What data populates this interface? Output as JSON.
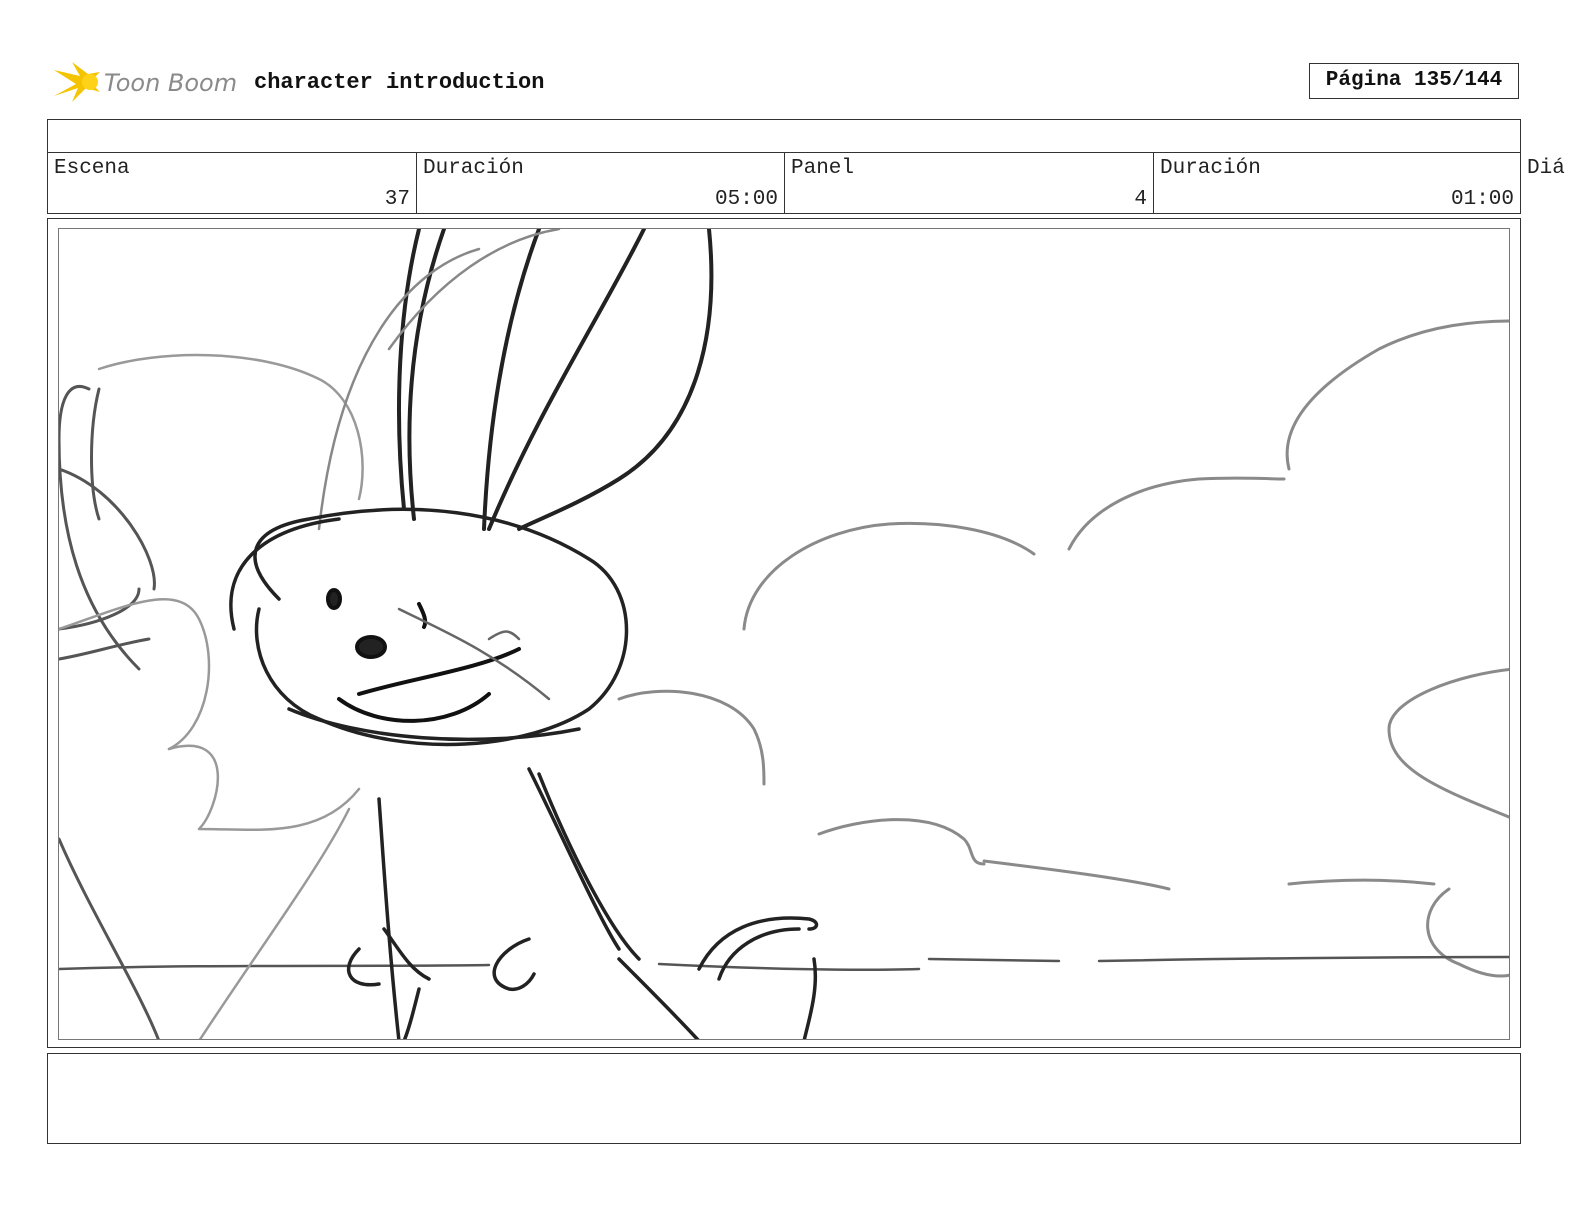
{
  "header": {
    "logo_text": "Toon Boom",
    "title": "character introduction",
    "page_label": "Página 135/144"
  },
  "info": {
    "scene_label": "Escena",
    "scene_value": "37",
    "scene_duration_label": "Duración",
    "scene_duration_value": "05:00",
    "panel_label": "Panel",
    "panel_value": "4",
    "panel_duration_label": "Duración",
    "panel_duration_value": "01:00",
    "dialogue_label": "Diá"
  },
  "colors": {
    "logo_star": "#f5c400",
    "logo_text": "#8a8a8a",
    "border": "#333333"
  }
}
